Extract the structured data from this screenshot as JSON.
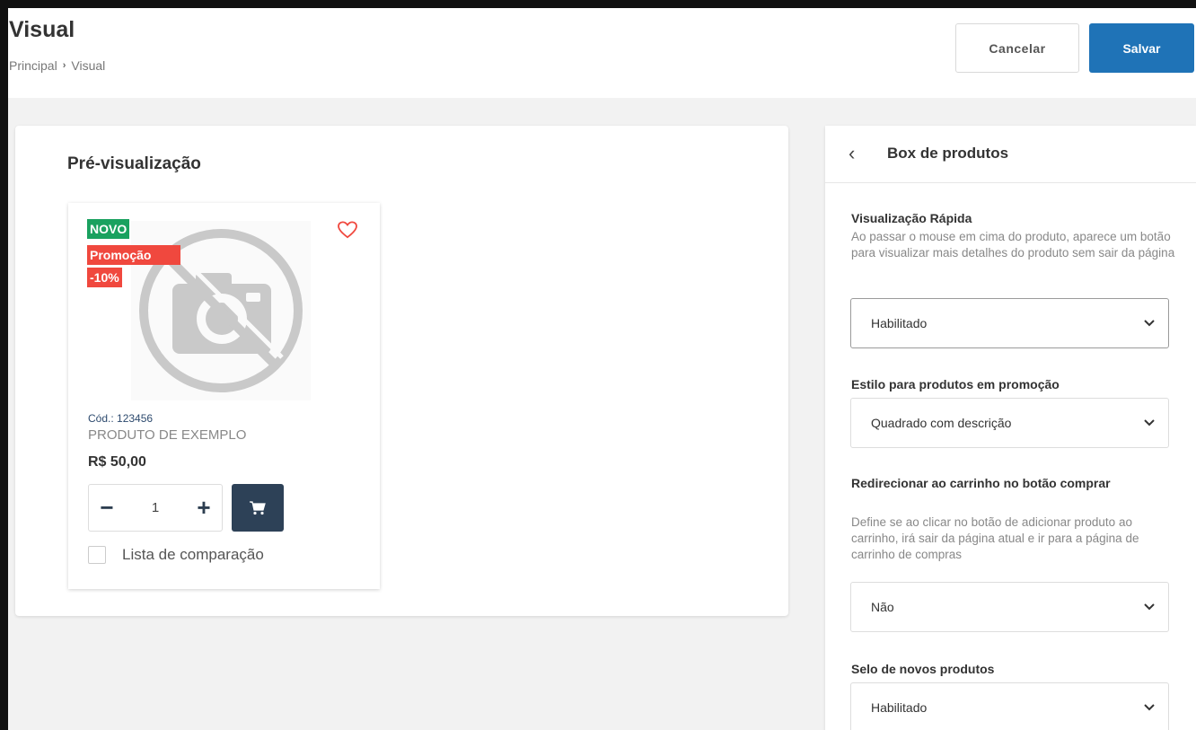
{
  "header": {
    "title": "Visual",
    "breadcrumb": {
      "home": "Principal",
      "separator": "›",
      "current": "Visual"
    },
    "cancel_label": "Cancelar",
    "save_label": "Salvar"
  },
  "preview": {
    "title": "Pré-visualização",
    "product": {
      "badge_new": "NOVO",
      "badge_promo": "Promoção",
      "badge_discount": "-10%",
      "code": "Cód.: 123456",
      "name": "PRODUTO DE EXEMPLO",
      "price": "R$ 50,00",
      "qty_minus": "−",
      "qty_value": "1",
      "qty_plus": "+",
      "compare_label": "Lista de comparação",
      "compare_checked": false
    }
  },
  "panel": {
    "title": "Box de produtos",
    "back_icon": "‹",
    "fields": [
      {
        "label": "Visualização Rápida",
        "description": "Ao passar o mouse em cima do produto, aparece um botão para visualizar mais detalhes do produto sem sair da página",
        "value": "Habilitado"
      },
      {
        "label": "Estilo para produtos em promoção",
        "description": "",
        "value": "Quadrado com descrição"
      },
      {
        "label": "Redirecionar ao carrinho no botão comprar",
        "description": "Define se ao clicar no botão de adicionar produto ao carrinho, irá sair da página atual e ir para a página de carrinho de compras",
        "value": "Não"
      },
      {
        "label": "Selo de novos produtos",
        "description": "",
        "value": "Habilitado"
      }
    ]
  },
  "colors": {
    "primary": "#1f73b7",
    "badge_new": "#1aa15f",
    "badge_promo": "#f0483e",
    "cart_button": "#2d4157"
  }
}
